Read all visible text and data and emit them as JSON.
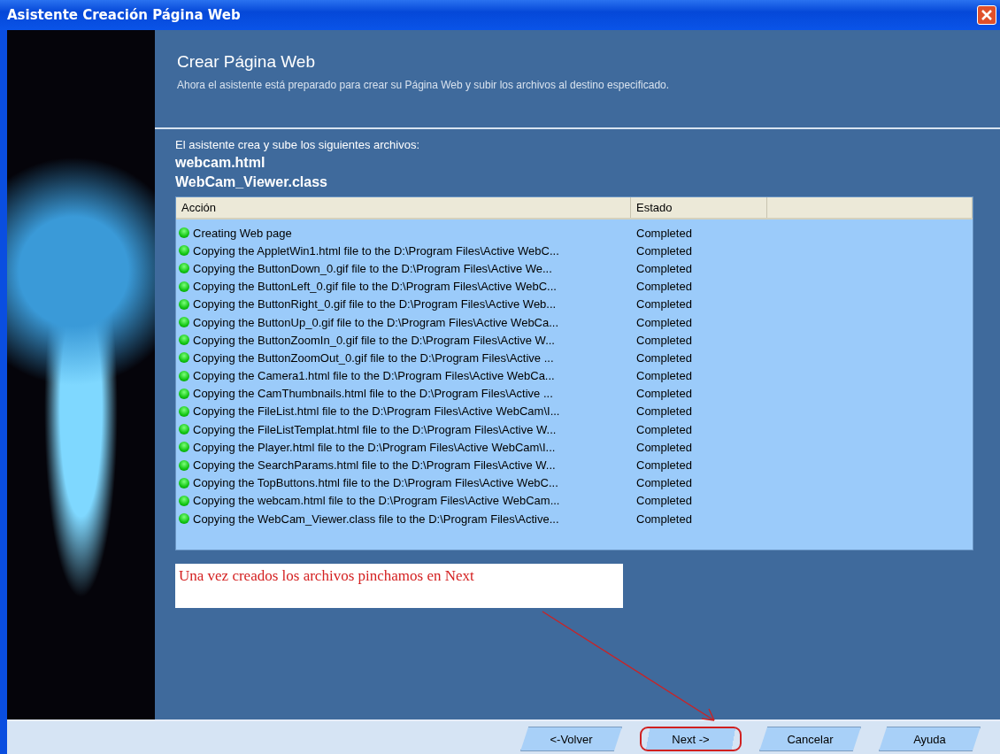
{
  "window": {
    "title": "Asistente Creación Página Web"
  },
  "header": {
    "title": "Crear Página Web",
    "subtitle": "Ahora el asistente está preparado para crear su Página Web y subir los archivos al destino especificado."
  },
  "files": {
    "intro": "El asistente crea y sube los siguientes archivos:",
    "names": [
      "webcam.html",
      "WebCam_Viewer.class"
    ]
  },
  "table": {
    "columns": [
      "Acción",
      "Estado"
    ],
    "rows": [
      {
        "action": "Creating Web page",
        "status": "Completed"
      },
      {
        "action": "Copying the AppletWin1.html file to the D:\\Program Files\\Active WebC...",
        "status": "Completed"
      },
      {
        "action": "Copying the ButtonDown_0.gif file to the D:\\Program Files\\Active We...",
        "status": "Completed"
      },
      {
        "action": "Copying the ButtonLeft_0.gif file to the D:\\Program Files\\Active WebC...",
        "status": "Completed"
      },
      {
        "action": "Copying the ButtonRight_0.gif file to the D:\\Program Files\\Active Web...",
        "status": "Completed"
      },
      {
        "action": "Copying the ButtonUp_0.gif file to the D:\\Program Files\\Active WebCa...",
        "status": "Completed"
      },
      {
        "action": "Copying the ButtonZoomIn_0.gif file to the D:\\Program Files\\Active W...",
        "status": "Completed"
      },
      {
        "action": "Copying the ButtonZoomOut_0.gif file to the D:\\Program Files\\Active ...",
        "status": "Completed"
      },
      {
        "action": "Copying the Camera1.html file to the D:\\Program Files\\Active WebCa...",
        "status": "Completed"
      },
      {
        "action": "Copying the CamThumbnails.html file to the D:\\Program Files\\Active ...",
        "status": "Completed"
      },
      {
        "action": "Copying the FileList.html file to the D:\\Program Files\\Active WebCam\\I...",
        "status": "Completed"
      },
      {
        "action": "Copying the FileListTemplat.html file to the D:\\Program Files\\Active W...",
        "status": "Completed"
      },
      {
        "action": "Copying the Player.html file to the D:\\Program Files\\Active WebCam\\I...",
        "status": "Completed"
      },
      {
        "action": "Copying the SearchParams.html file to the D:\\Program Files\\Active W...",
        "status": "Completed"
      },
      {
        "action": "Copying the TopButtons.html file to the D:\\Program Files\\Active WebC...",
        "status": "Completed"
      },
      {
        "action": "Copying the webcam.html file to the D:\\Program Files\\Active WebCam...",
        "status": "Completed"
      },
      {
        "action": "Copying the WebCam_Viewer.class file to the D:\\Program Files\\Active...",
        "status": "Completed"
      }
    ]
  },
  "annotation": {
    "text": "Una vez creados los archivos pinchamos en Next"
  },
  "buttons": [
    {
      "label": "<-Volver",
      "highlighted": false
    },
    {
      "label": "Next ->",
      "highlighted": true
    },
    {
      "label": "Cancelar",
      "highlighted": false
    },
    {
      "label": "Ayuda",
      "highlighted": false
    }
  ]
}
